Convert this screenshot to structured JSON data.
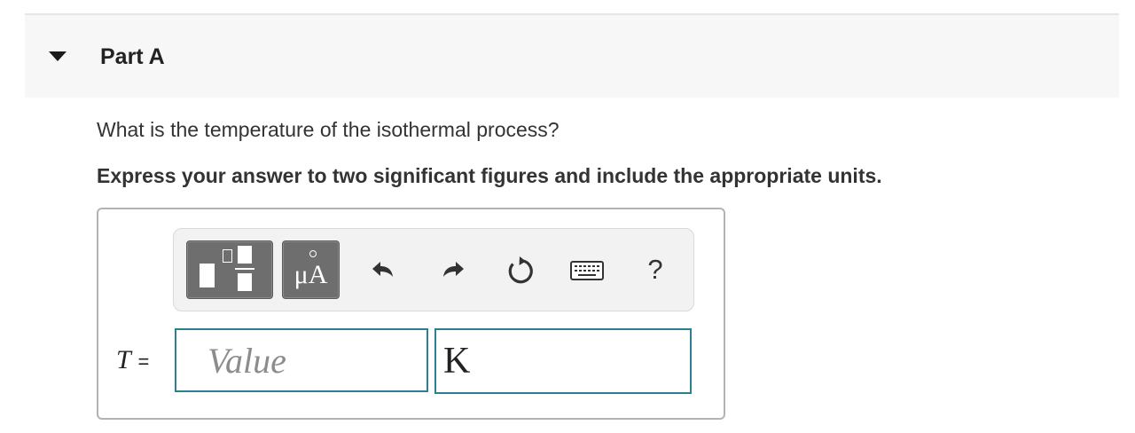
{
  "part": {
    "title": "Part A",
    "expanded": true
  },
  "question": {
    "prompt": "What is the temperature of the isothermal process?",
    "instruction": "Express your answer to two significant figures and include the appropriate units."
  },
  "toolbar": {
    "buttons": [
      {
        "name": "templates",
        "icon": "templates-icon"
      },
      {
        "name": "units",
        "label": "μA"
      },
      {
        "name": "undo",
        "icon": "undo-icon"
      },
      {
        "name": "redo",
        "icon": "redo-icon"
      },
      {
        "name": "reset",
        "icon": "reset-icon"
      },
      {
        "name": "keyboard",
        "icon": "keyboard-icon"
      },
      {
        "name": "help",
        "label": "?"
      }
    ]
  },
  "answer": {
    "variable": "T",
    "equals": "=",
    "value_placeholder": "Value",
    "value": "",
    "unit": "K"
  },
  "colors": {
    "input_border": "#2a7f91",
    "toolbar_button": "#6e6e6e",
    "header_background": "#f7f7f7"
  }
}
